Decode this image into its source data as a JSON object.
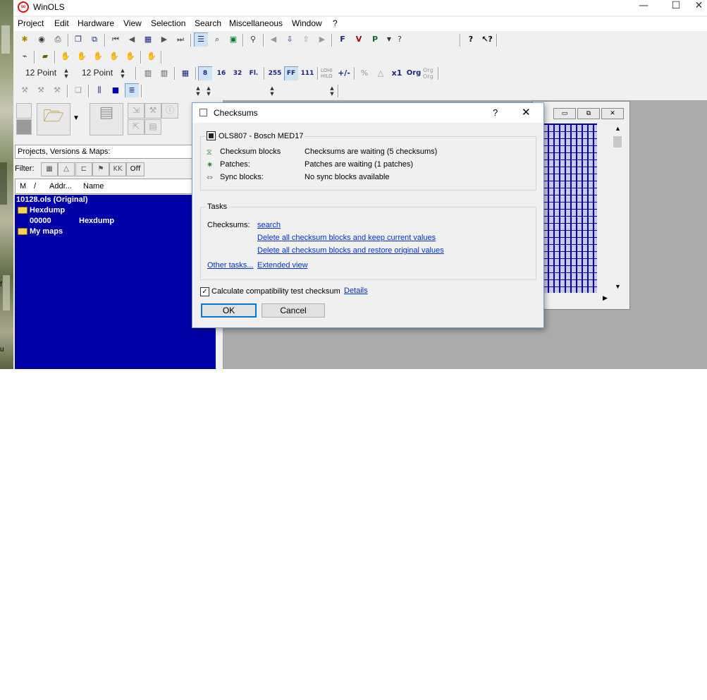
{
  "app": {
    "title": "WinOLS"
  },
  "menu": [
    "Project",
    "Edit",
    "Hardware",
    "View",
    "Selection",
    "Search",
    "Miscellaneous",
    "Window",
    "?"
  ],
  "toolbar": {
    "font_size_1": "12 Point",
    "font_size_2": "12 Point",
    "btn_8": "8",
    "btn_16": "16",
    "btn_32": "32",
    "btn_fl": "Fl.",
    "btn_255": "255",
    "btn_ff": "FF",
    "btn_111": "111",
    "btn_lohi": "LOHI",
    "btn_hilo": "HILO",
    "btn_x1": "x1",
    "btn_org": "Org",
    "btn_orgorg_1": "Org",
    "btn_orgorg_2": "Org",
    "btn_f": "F",
    "btn_v": "V",
    "btn_p": "P",
    "btn_q": "?"
  },
  "left_panel": {
    "combo_label": "Projects, Versions & Maps:",
    "filter_label": "Filter:",
    "filter_off": "Off",
    "filter_kk": "KK",
    "columns": [
      "M",
      "/",
      "Addr...",
      "Name"
    ],
    "tree": {
      "root": "10128.ols (Original)",
      "hexdump_folder": "Hexdump",
      "hexdump_addr": "00000",
      "hexdump_name": "Hexdump",
      "mymaps_folder": "My maps"
    }
  },
  "dialog": {
    "title": "Checksums",
    "help": "?",
    "project_group": "OLS807 - Bosch MED17",
    "rows": [
      {
        "label": "Checksum blocks",
        "value": "Checksums are waiting (5 checksums)",
        "icon": "checksum-blocks-icon"
      },
      {
        "label": "Patches:",
        "value": "Patches are waiting (1 patches)",
        "icon": "patch-icon"
      },
      {
        "label": "Sync blocks:",
        "value": "No sync blocks available",
        "icon": "sync-icon"
      }
    ],
    "tasks_group": "Tasks",
    "checksums_label": "Checksums:",
    "link_search": "search",
    "link_delete_keep": "Delete all checksum blocks and keep current values",
    "link_delete_restore": "Delete all checksum blocks and restore original values",
    "link_other_tasks": "Other tasks...",
    "link_extended": "Extended view",
    "compat_checkbox": "Calculate compatibility test checksum",
    "compat_checked": true,
    "link_details": "Details",
    "ok": "OK",
    "cancel": "Cancel"
  },
  "desktop_labels": {
    "f": "f",
    "u": "u"
  }
}
